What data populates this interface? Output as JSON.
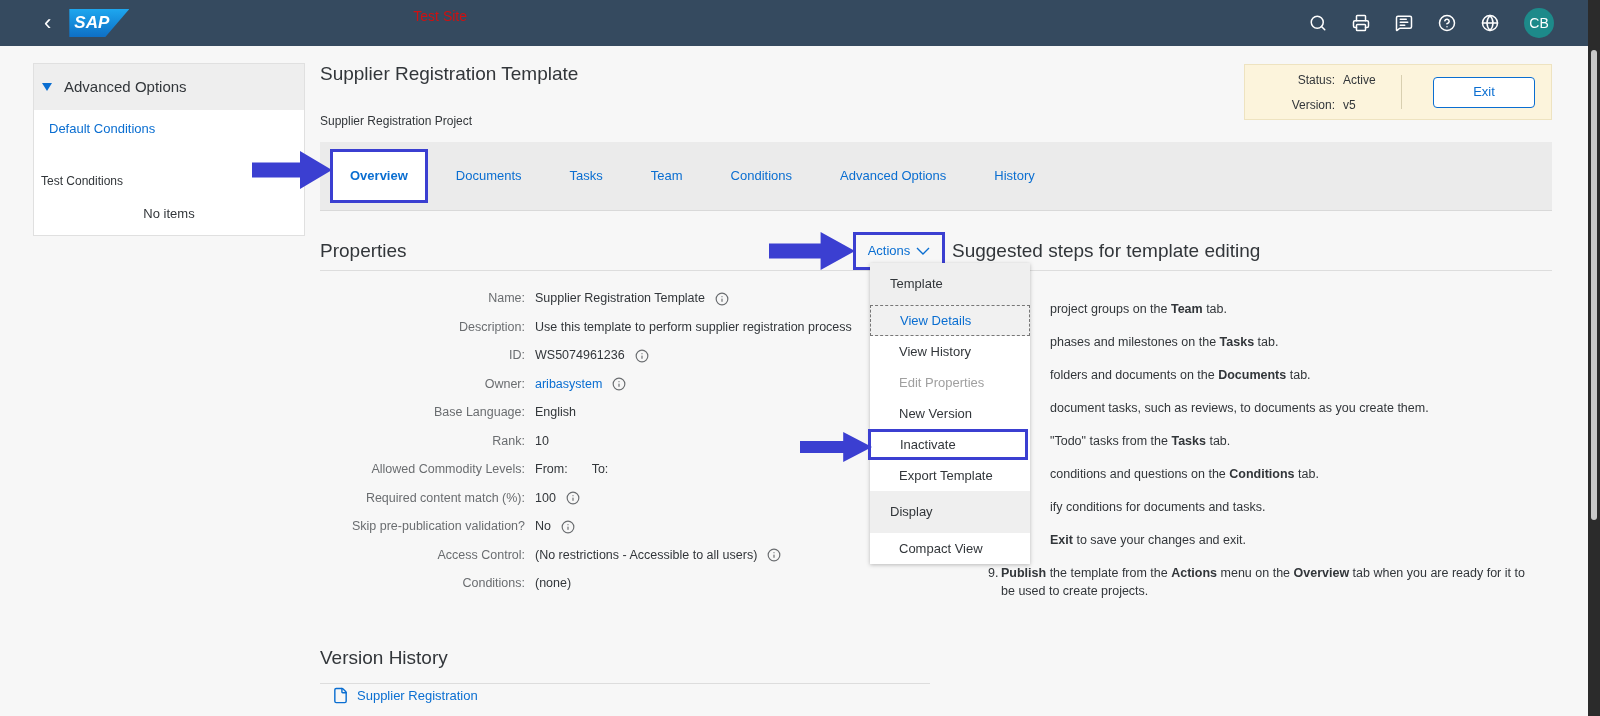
{
  "header": {
    "back": "‹",
    "logo": "SAP",
    "site_label": "Test Site",
    "avatar": "CB"
  },
  "sidebar": {
    "section": {
      "label": "Advanced Options",
      "expanded": true
    },
    "links": [
      "Default Conditions"
    ],
    "groups": [
      {
        "label": "Test Conditions",
        "empty_text": "No items"
      }
    ]
  },
  "page": {
    "title": "Supplier Registration Template",
    "subtitle": "Supplier Registration Project",
    "status": [
      {
        "label": "Status:",
        "value": "Active"
      },
      {
        "label": "Version:",
        "value": "v5"
      }
    ],
    "exit_button": "Exit"
  },
  "tabs": [
    {
      "label": "Overview",
      "selected": true,
      "annotated": true
    },
    {
      "label": "Documents",
      "selected": false,
      "annotated": false
    },
    {
      "label": "Tasks",
      "selected": false,
      "annotated": false
    },
    {
      "label": "Team",
      "selected": false,
      "annotated": false
    },
    {
      "label": "Conditions",
      "selected": false,
      "annotated": false
    },
    {
      "label": "Advanced Options",
      "selected": false,
      "annotated": false
    },
    {
      "label": "History",
      "selected": false,
      "annotated": false
    }
  ],
  "properties": {
    "title": "Properties",
    "actions_button": {
      "label": "Actions",
      "annotated": true
    },
    "rows": [
      {
        "label": "Name:",
        "values": [
          "Supplier Registration Template"
        ],
        "kind": "text",
        "info": true
      },
      {
        "label": "Description:",
        "values": [
          "Use this template to perform supplier registration process"
        ],
        "kind": "text",
        "info": false
      },
      {
        "label": "ID:",
        "values": [
          "WS5074961236"
        ],
        "kind": "text",
        "info": true
      },
      {
        "label": "Owner:",
        "values": [
          "aribasystem"
        ],
        "kind": "link",
        "info": true
      },
      {
        "label": "Base Language:",
        "values": [
          "English"
        ],
        "kind": "text",
        "info": false
      },
      {
        "label": "Rank:",
        "values": [
          "10"
        ],
        "kind": "text",
        "info": false
      },
      {
        "label": "Allowed Commodity Levels:",
        "values": [
          "From:",
          "To:"
        ],
        "kind": "text",
        "info": false
      },
      {
        "label": "Required content match (%):",
        "values": [
          "100"
        ],
        "kind": "text",
        "info": true
      },
      {
        "label": "Skip pre-publication validation?",
        "values": [
          "No"
        ],
        "kind": "text",
        "info": true
      },
      {
        "label": "Access Control:",
        "values": [
          "(No restrictions - Accessible to all users)"
        ],
        "kind": "text",
        "info": true
      },
      {
        "label": "Conditions:",
        "values": [
          "(none)"
        ],
        "kind": "text",
        "info": false
      }
    ]
  },
  "actions_menu": [
    {
      "kind": "header",
      "label": "Template"
    },
    {
      "kind": "item",
      "label": "View Details",
      "focused": true,
      "disabled": false,
      "annotated": false
    },
    {
      "kind": "item",
      "label": "View History",
      "focused": false,
      "disabled": false,
      "annotated": false
    },
    {
      "kind": "item",
      "label": "Edit Properties",
      "focused": false,
      "disabled": true,
      "annotated": false
    },
    {
      "kind": "item",
      "label": "New Version",
      "focused": false,
      "disabled": false,
      "annotated": false
    },
    {
      "kind": "item",
      "label": "Inactivate",
      "focused": false,
      "disabled": false,
      "annotated": true
    },
    {
      "kind": "item",
      "label": "Export Template",
      "focused": false,
      "disabled": false,
      "annotated": false
    },
    {
      "kind": "header",
      "label": "Display"
    },
    {
      "kind": "item",
      "label": "Compact View",
      "focused": false,
      "disabled": false,
      "annotated": false
    }
  ],
  "steps": {
    "title": "Suggested steps for template editing",
    "items": [
      {
        "text": "project groups on the **Team** tab."
      },
      {
        "text": "phases and milestones on the **Tasks** tab."
      },
      {
        "text": "folders and documents on the **Documents** tab."
      },
      {
        "text": "document tasks, such as reviews, to documents as you create them."
      },
      {
        "text": "\"Todo\" tasks from the **Tasks** tab."
      },
      {
        "text": "conditions and questions on the **Conditions** tab."
      },
      {
        "text": "ify conditions for documents and tasks."
      },
      {
        "text": "**Exit** to save your changes and exit."
      },
      {
        "number": "9.",
        "text": "**Publish** the template from the **Actions** menu on the **Overview** tab when you are ready for it to be used to create projects."
      }
    ]
  },
  "version_history": {
    "title": "Version History",
    "items": [
      "Supplier Registration"
    ]
  }
}
